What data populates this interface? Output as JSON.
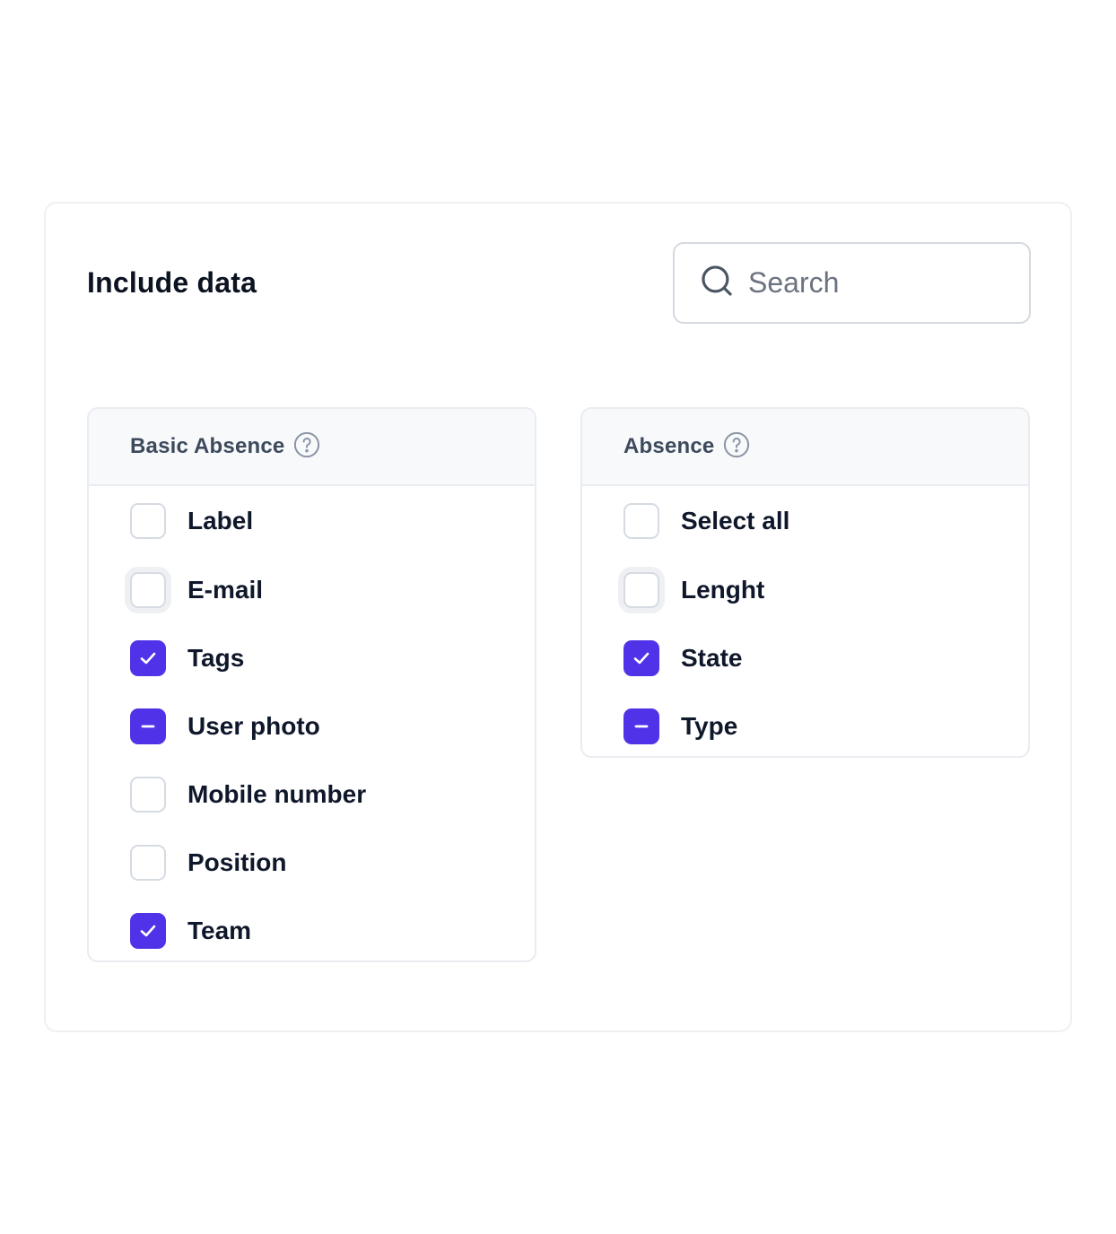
{
  "title": "Include data",
  "search": {
    "placeholder": "Search",
    "value": ""
  },
  "colors": {
    "accent": "#5033e8",
    "border": "#d6dbe2",
    "header_bg": "#f7f9fb"
  },
  "panels": [
    {
      "header": "Basic Absence",
      "help_icon": "question-circle-icon",
      "items": [
        {
          "label": "Label",
          "state": "unchecked"
        },
        {
          "label": "E-mail",
          "state": "unchecked-focused"
        },
        {
          "label": "Tags",
          "state": "checked"
        },
        {
          "label": "User photo",
          "state": "indeterminate"
        },
        {
          "label": "Mobile number",
          "state": "unchecked"
        },
        {
          "label": "Position",
          "state": "unchecked"
        },
        {
          "label": "Team",
          "state": "checked"
        }
      ]
    },
    {
      "header": "Absence",
      "help_icon": "question-circle-icon",
      "items": [
        {
          "label": "Select all",
          "state": "unchecked"
        },
        {
          "label": "Lenght",
          "state": "unchecked-focused"
        },
        {
          "label": "State",
          "state": "checked"
        },
        {
          "label": "Type",
          "state": "indeterminate"
        }
      ]
    }
  ]
}
